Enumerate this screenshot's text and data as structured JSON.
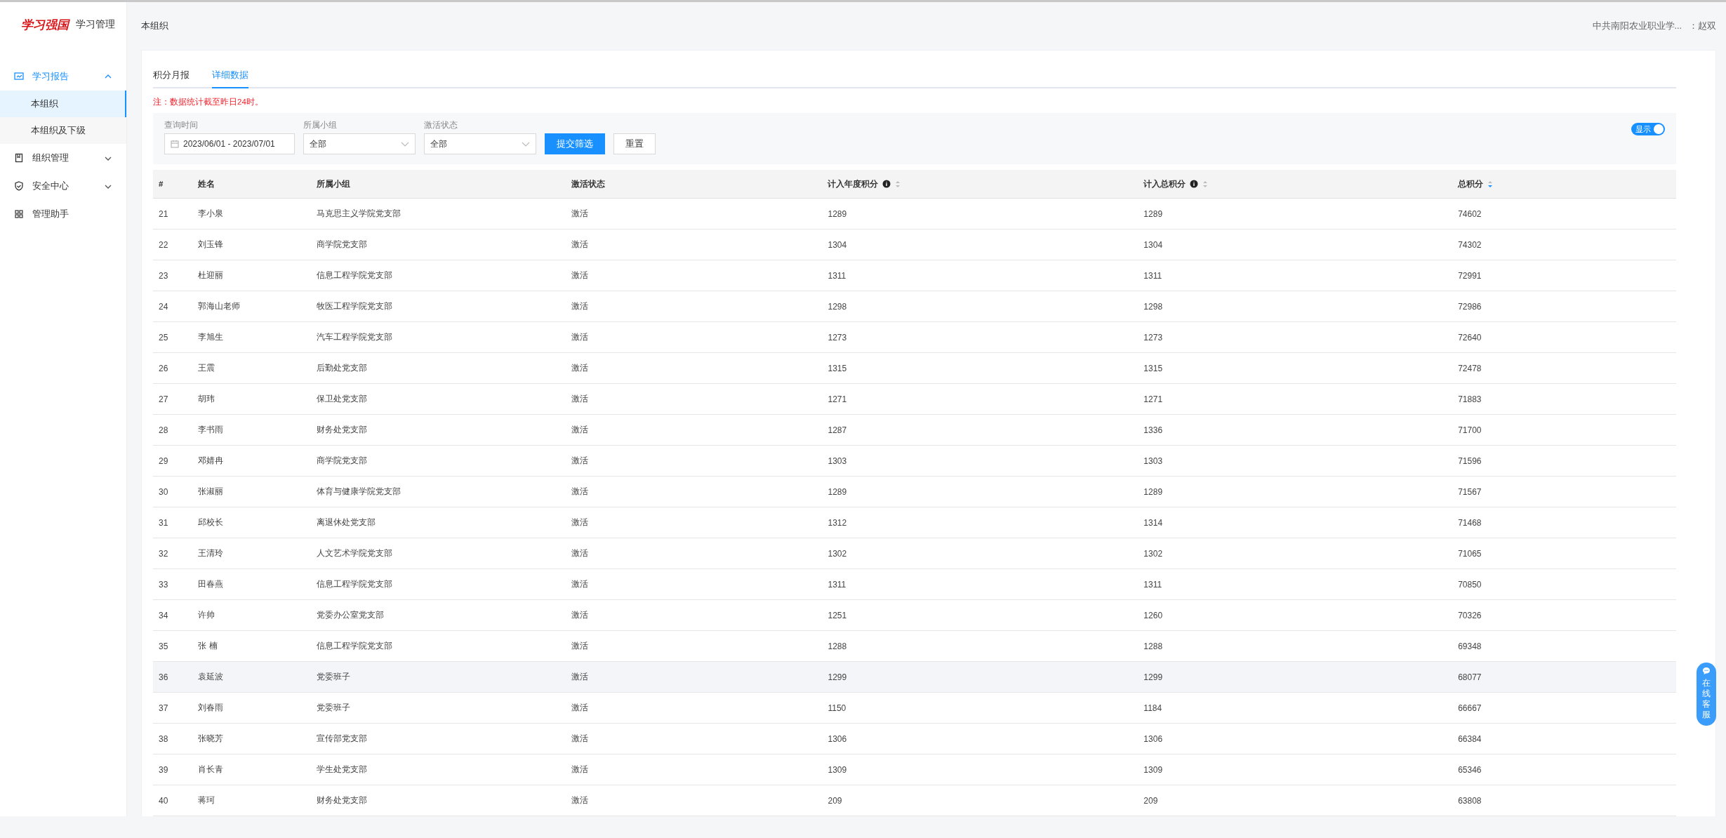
{
  "sidebar": {
    "logo": "学习强国",
    "app_title": "学习管理",
    "items": [
      {
        "label": "学习报告",
        "expanded": true,
        "children": [
          {
            "label": "本组织",
            "selected": true
          },
          {
            "label": "本组织及下级",
            "selected": false
          }
        ]
      },
      {
        "label": "组织管理",
        "expanded": false
      },
      {
        "label": "安全中心",
        "expanded": false
      },
      {
        "label": "管理助手"
      }
    ]
  },
  "header": {
    "title": "本组织",
    "org": "中共南阳农业职业学...",
    "user": "：赵双"
  },
  "tabs": [
    {
      "label": "积分月报",
      "selected": false
    },
    {
      "label": "详细数据",
      "selected": true
    }
  ],
  "note": "注：数据统计截至昨日24时。",
  "filters": {
    "fields": [
      {
        "kind": "date",
        "label": "查询时间",
        "value": "2023/06/01 - 2023/07/01"
      },
      {
        "kind": "select",
        "label": "所属小组",
        "value": "全部"
      },
      {
        "kind": "select",
        "label": "激活状态",
        "value": "全部"
      }
    ],
    "buttons": [
      {
        "label": "提交筛选",
        "kind": "primary"
      },
      {
        "label": "重置",
        "kind": "default"
      }
    ],
    "toggle": {
      "label": "显示",
      "on": true
    }
  },
  "table": {
    "columns": [
      {
        "label": "#"
      },
      {
        "label": "姓名"
      },
      {
        "label": "所属小组"
      },
      {
        "label": "激活状态"
      },
      {
        "label": "计入年度积分",
        "info": true,
        "sortable": true,
        "sorted_descending": false
      },
      {
        "label": "计入总积分",
        "info": true,
        "sortable": true,
        "sorted_descending": false
      },
      {
        "label": "总积分",
        "sortable": true,
        "sorted_descending": true
      }
    ],
    "rows": [
      {
        "cells": [
          "21",
          "李小泉",
          "马克思主义学院党支部",
          "激活",
          "1289",
          "1289",
          "74602"
        ],
        "hovered": false
      },
      {
        "cells": [
          "22",
          "刘玉锋",
          "商学院党支部",
          "激活",
          "1304",
          "1304",
          "74302"
        ],
        "hovered": false
      },
      {
        "cells": [
          "23",
          "杜迎丽",
          "信息工程学院党支部",
          "激活",
          "1311",
          "1311",
          "72991"
        ],
        "hovered": false
      },
      {
        "cells": [
          "24",
          "郭海山老师",
          "牧医工程学院党支部",
          "激活",
          "1298",
          "1298",
          "72986"
        ],
        "hovered": false
      },
      {
        "cells": [
          "25",
          "李旭生",
          "汽车工程学院党支部",
          "激活",
          "1273",
          "1273",
          "72640"
        ],
        "hovered": false
      },
      {
        "cells": [
          "26",
          "王震",
          "后勤处党支部",
          "激活",
          "1315",
          "1315",
          "72478"
        ],
        "hovered": false
      },
      {
        "cells": [
          "27",
          "胡玮",
          "保卫处党支部",
          "激活",
          "1271",
          "1271",
          "71883"
        ],
        "hovered": false
      },
      {
        "cells": [
          "28",
          "李书雨",
          "财务处党支部",
          "激活",
          "1287",
          "1336",
          "71700"
        ],
        "hovered": false
      },
      {
        "cells": [
          "29",
          "邓婧冉",
          "商学院党支部",
          "激活",
          "1303",
          "1303",
          "71596"
        ],
        "hovered": false
      },
      {
        "cells": [
          "30",
          "张淑丽",
          "体育与健康学院党支部",
          "激活",
          "1289",
          "1289",
          "71567"
        ],
        "hovered": false
      },
      {
        "cells": [
          "31",
          "邱校长",
          "离退休处党支部",
          "激活",
          "1312",
          "1314",
          "71468"
        ],
        "hovered": false
      },
      {
        "cells": [
          "32",
          "王清玲",
          "人文艺术学院党支部",
          "激活",
          "1302",
          "1302",
          "71065"
        ],
        "hovered": false
      },
      {
        "cells": [
          "33",
          "田春燕",
          "信息工程学院党支部",
          "激活",
          "1311",
          "1311",
          "70850"
        ],
        "hovered": false
      },
      {
        "cells": [
          "34",
          "许帅",
          "党委办公室党支部",
          "激活",
          "1251",
          "1260",
          "70326"
        ],
        "hovered": false
      },
      {
        "cells": [
          "35",
          "张 楠",
          "信息工程学院党支部",
          "激活",
          "1288",
          "1288",
          "69348"
        ],
        "hovered": false
      },
      {
        "cells": [
          "36",
          "袁延波",
          "党委班子",
          "激活",
          "1299",
          "1299",
          "68077"
        ],
        "hovered": true
      },
      {
        "cells": [
          "37",
          "刘春雨",
          "党委班子",
          "激活",
          "1150",
          "1184",
          "66667"
        ],
        "hovered": false
      },
      {
        "cells": [
          "38",
          "张晓芳",
          "宣传部党支部",
          "激活",
          "1306",
          "1306",
          "66384"
        ],
        "hovered": false
      },
      {
        "cells": [
          "39",
          "肖长青",
          "学生处党支部",
          "激活",
          "1309",
          "1309",
          "65346"
        ],
        "hovered": false
      },
      {
        "cells": [
          "40",
          "蒋珂",
          "财务处党支部",
          "激活",
          "209",
          "209",
          "63808"
        ],
        "hovered": false
      }
    ]
  },
  "chat_button": {
    "label": "在线客服"
  }
}
